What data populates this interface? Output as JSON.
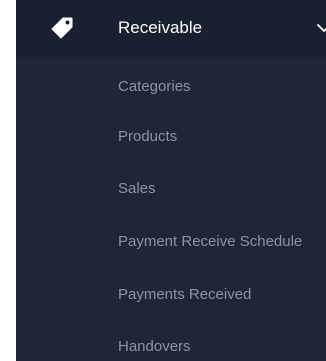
{
  "menu": {
    "title": "Receivable",
    "icon": "tag-icon",
    "expand_icon": "chevron-down-icon",
    "items": [
      {
        "label": "Categories"
      },
      {
        "label": "Products"
      },
      {
        "label": "Sales"
      },
      {
        "label": "Payment Receive Schedule"
      },
      {
        "label": "Payments Received"
      },
      {
        "label": "Handovers"
      }
    ]
  },
  "colors": {
    "sidebar_bg": "#1f2637",
    "header_bg": "#1a2030",
    "header_text": "#ffffff",
    "item_text": "#8c93a4"
  }
}
